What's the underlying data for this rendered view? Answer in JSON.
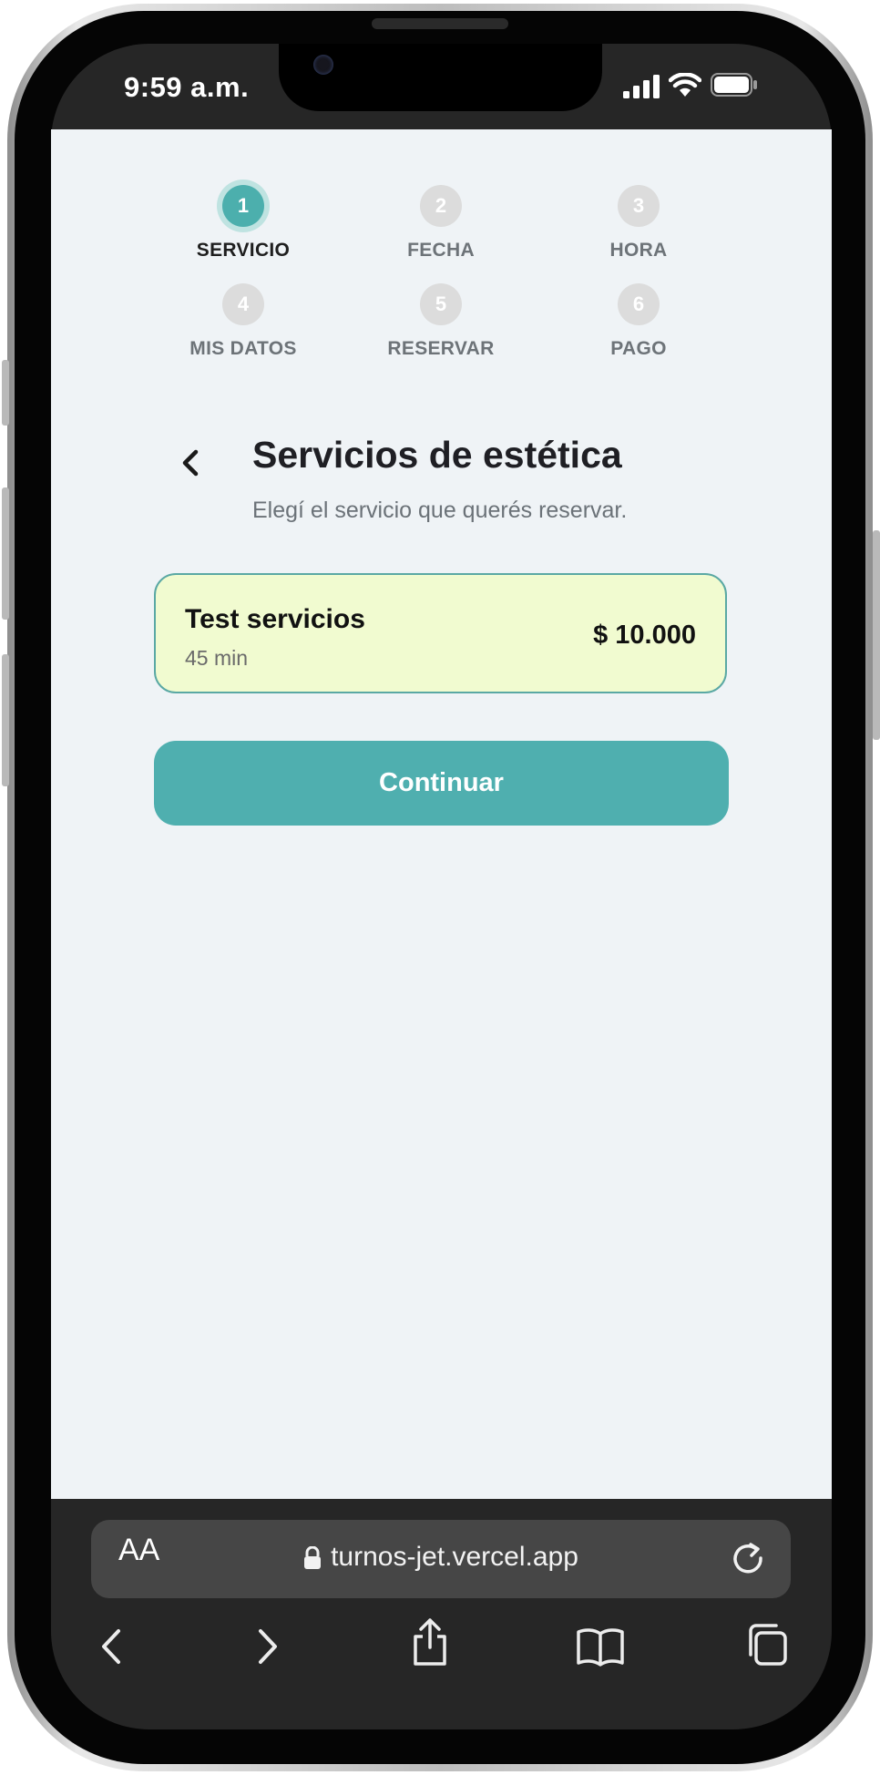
{
  "status_bar": {
    "time": "9:59 a.m."
  },
  "steps": [
    {
      "number": "1",
      "label": "SERVICIO",
      "active": true
    },
    {
      "number": "2",
      "label": "FECHA",
      "active": false
    },
    {
      "number": "3",
      "label": "HORA",
      "active": false
    },
    {
      "number": "4",
      "label": "MIS DATOS",
      "active": false
    },
    {
      "number": "5",
      "label": "RESERVAR",
      "active": false
    },
    {
      "number": "6",
      "label": "PAGO",
      "active": false
    }
  ],
  "header": {
    "title": "Servicios de estética",
    "subtitle": "Elegí el servicio que querés reservar."
  },
  "service": {
    "name": "Test servicios",
    "duration": "45 min",
    "price": "$ 10.000"
  },
  "continue_label": "Continuar",
  "browser": {
    "text_size_label": "AA",
    "url": "turnos-jet.vercel.app"
  },
  "colors": {
    "accent": "#4fafaf",
    "card_bg": "#f1fbd0",
    "page_bg": "#eff3f6"
  },
  "icons": [
    "chevron-left-icon",
    "lock-icon",
    "reload-icon",
    "back-arrow-icon",
    "forward-arrow-icon",
    "share-icon",
    "bookmarks-icon",
    "tabs-icon",
    "signal-icon",
    "wifi-icon",
    "battery-icon"
  ]
}
